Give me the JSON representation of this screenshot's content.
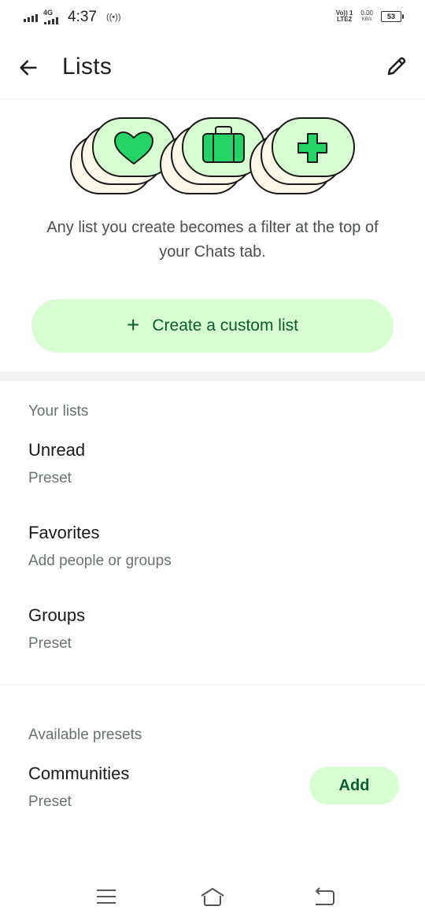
{
  "status_bar": {
    "net_tag": "4G",
    "time": "4:37",
    "volte_top": "Vo)) 1",
    "volte_bottom": "LTE2",
    "speed_value": "0.00",
    "speed_unit": "KB/s",
    "battery": "53",
    "icons": [
      "signal-icon",
      "signal-4g-icon",
      "hotspot-icon",
      "volte-icon",
      "battery-icon"
    ]
  },
  "app_bar": {
    "title": "Lists",
    "back_icon": "arrow-left-icon",
    "edit_icon": "pencil-icon"
  },
  "hero": {
    "icons": [
      "heart-icon",
      "briefcase-icon",
      "plus-icon"
    ],
    "description": "Any list you create becomes a filter at the top of your Chats tab."
  },
  "create_button": {
    "icon": "+",
    "label": "Create a custom list"
  },
  "your_lists": {
    "header": "Your lists",
    "items": [
      {
        "title": "Unread",
        "subtitle": "Preset"
      },
      {
        "title": "Favorites",
        "subtitle": "Add people or groups"
      },
      {
        "title": "Groups",
        "subtitle": "Preset"
      }
    ]
  },
  "available_presets": {
    "header": "Available presets",
    "items": [
      {
        "title": "Communities",
        "subtitle": "Preset",
        "action": "Add"
      }
    ]
  },
  "nav_bar": {
    "icons": [
      "menu-icon",
      "home-icon",
      "back-nav-icon"
    ]
  },
  "colors": {
    "accent_green": "#25d366",
    "accent_dark_green": "#0b5c2e",
    "pill_bg": "#d9fdd3",
    "card_cream": "#fdf7ea"
  }
}
